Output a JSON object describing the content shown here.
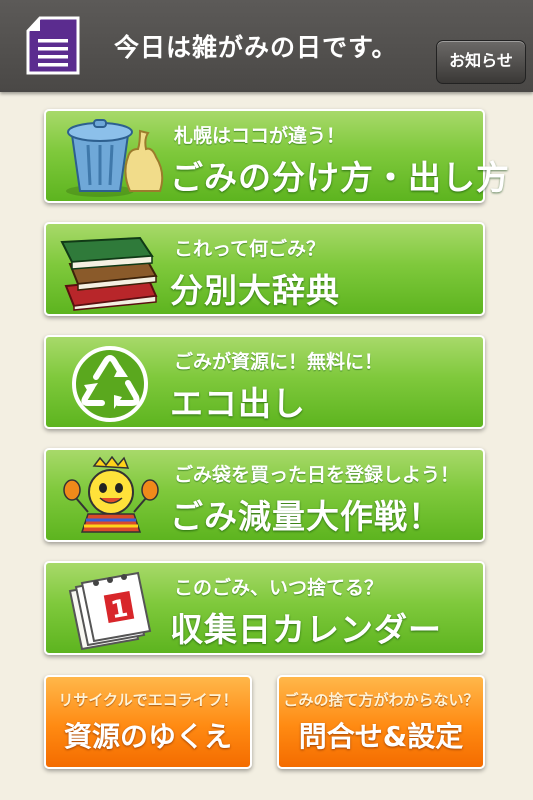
{
  "header": {
    "title": "今日は雑がみの日です。",
    "notice_button": "お知らせ",
    "doc_icon": "document-icon"
  },
  "menu": [
    {
      "sub": "札幌はココが違う！",
      "label": "ごみの分け方・出し方",
      "icon": "trash-can-icon"
    },
    {
      "sub": "これって何ごみ？",
      "label": "分別大辞典",
      "icon": "books-icon"
    },
    {
      "sub": "ごみが資源に！無料に！",
      "label": "エコ出し",
      "icon": "recycle-icon"
    },
    {
      "sub": "ごみ袋を買った日を登録しよう！",
      "label": "ごみ減量大作戦！",
      "icon": "mascot-icon"
    },
    {
      "sub": "このごみ、いつ捨てる？",
      "label": "収集日カレンダー",
      "icon": "calendar-icon",
      "calendar_number": "1"
    }
  ],
  "bottom": [
    {
      "sub": "リサイクルでエコライフ！",
      "label": "資源のゆくえ"
    },
    {
      "sub": "ごみの捨て方がわからない？",
      "label": "問合せ&設定"
    }
  ],
  "colors": {
    "header_bg": "#4f4d4b",
    "menu_green": "#6bbd2b",
    "bottom_orange": "#ff8a12",
    "doc_purple": "#5b2c8f",
    "background": "#f3efe2"
  }
}
